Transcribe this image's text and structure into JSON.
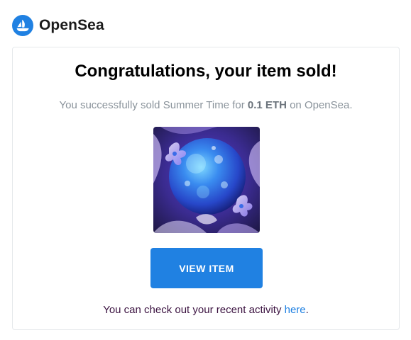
{
  "brand": {
    "name": "OpenSea",
    "logo_icon": "opensea-logo-icon",
    "accent_color": "#2081e2"
  },
  "notification": {
    "title": "Congratulations, your item sold!",
    "subtitle_prefix": "You successfully sold ",
    "item_name": "Summer Time",
    "subtitle_mid": " for ",
    "price": "0.1 ETH",
    "subtitle_suffix": " on OpenSea.",
    "view_button_label": "VIEW ITEM",
    "activity_prefix": "You can check out your recent activity ",
    "activity_link": "here",
    "activity_suffix": "."
  }
}
